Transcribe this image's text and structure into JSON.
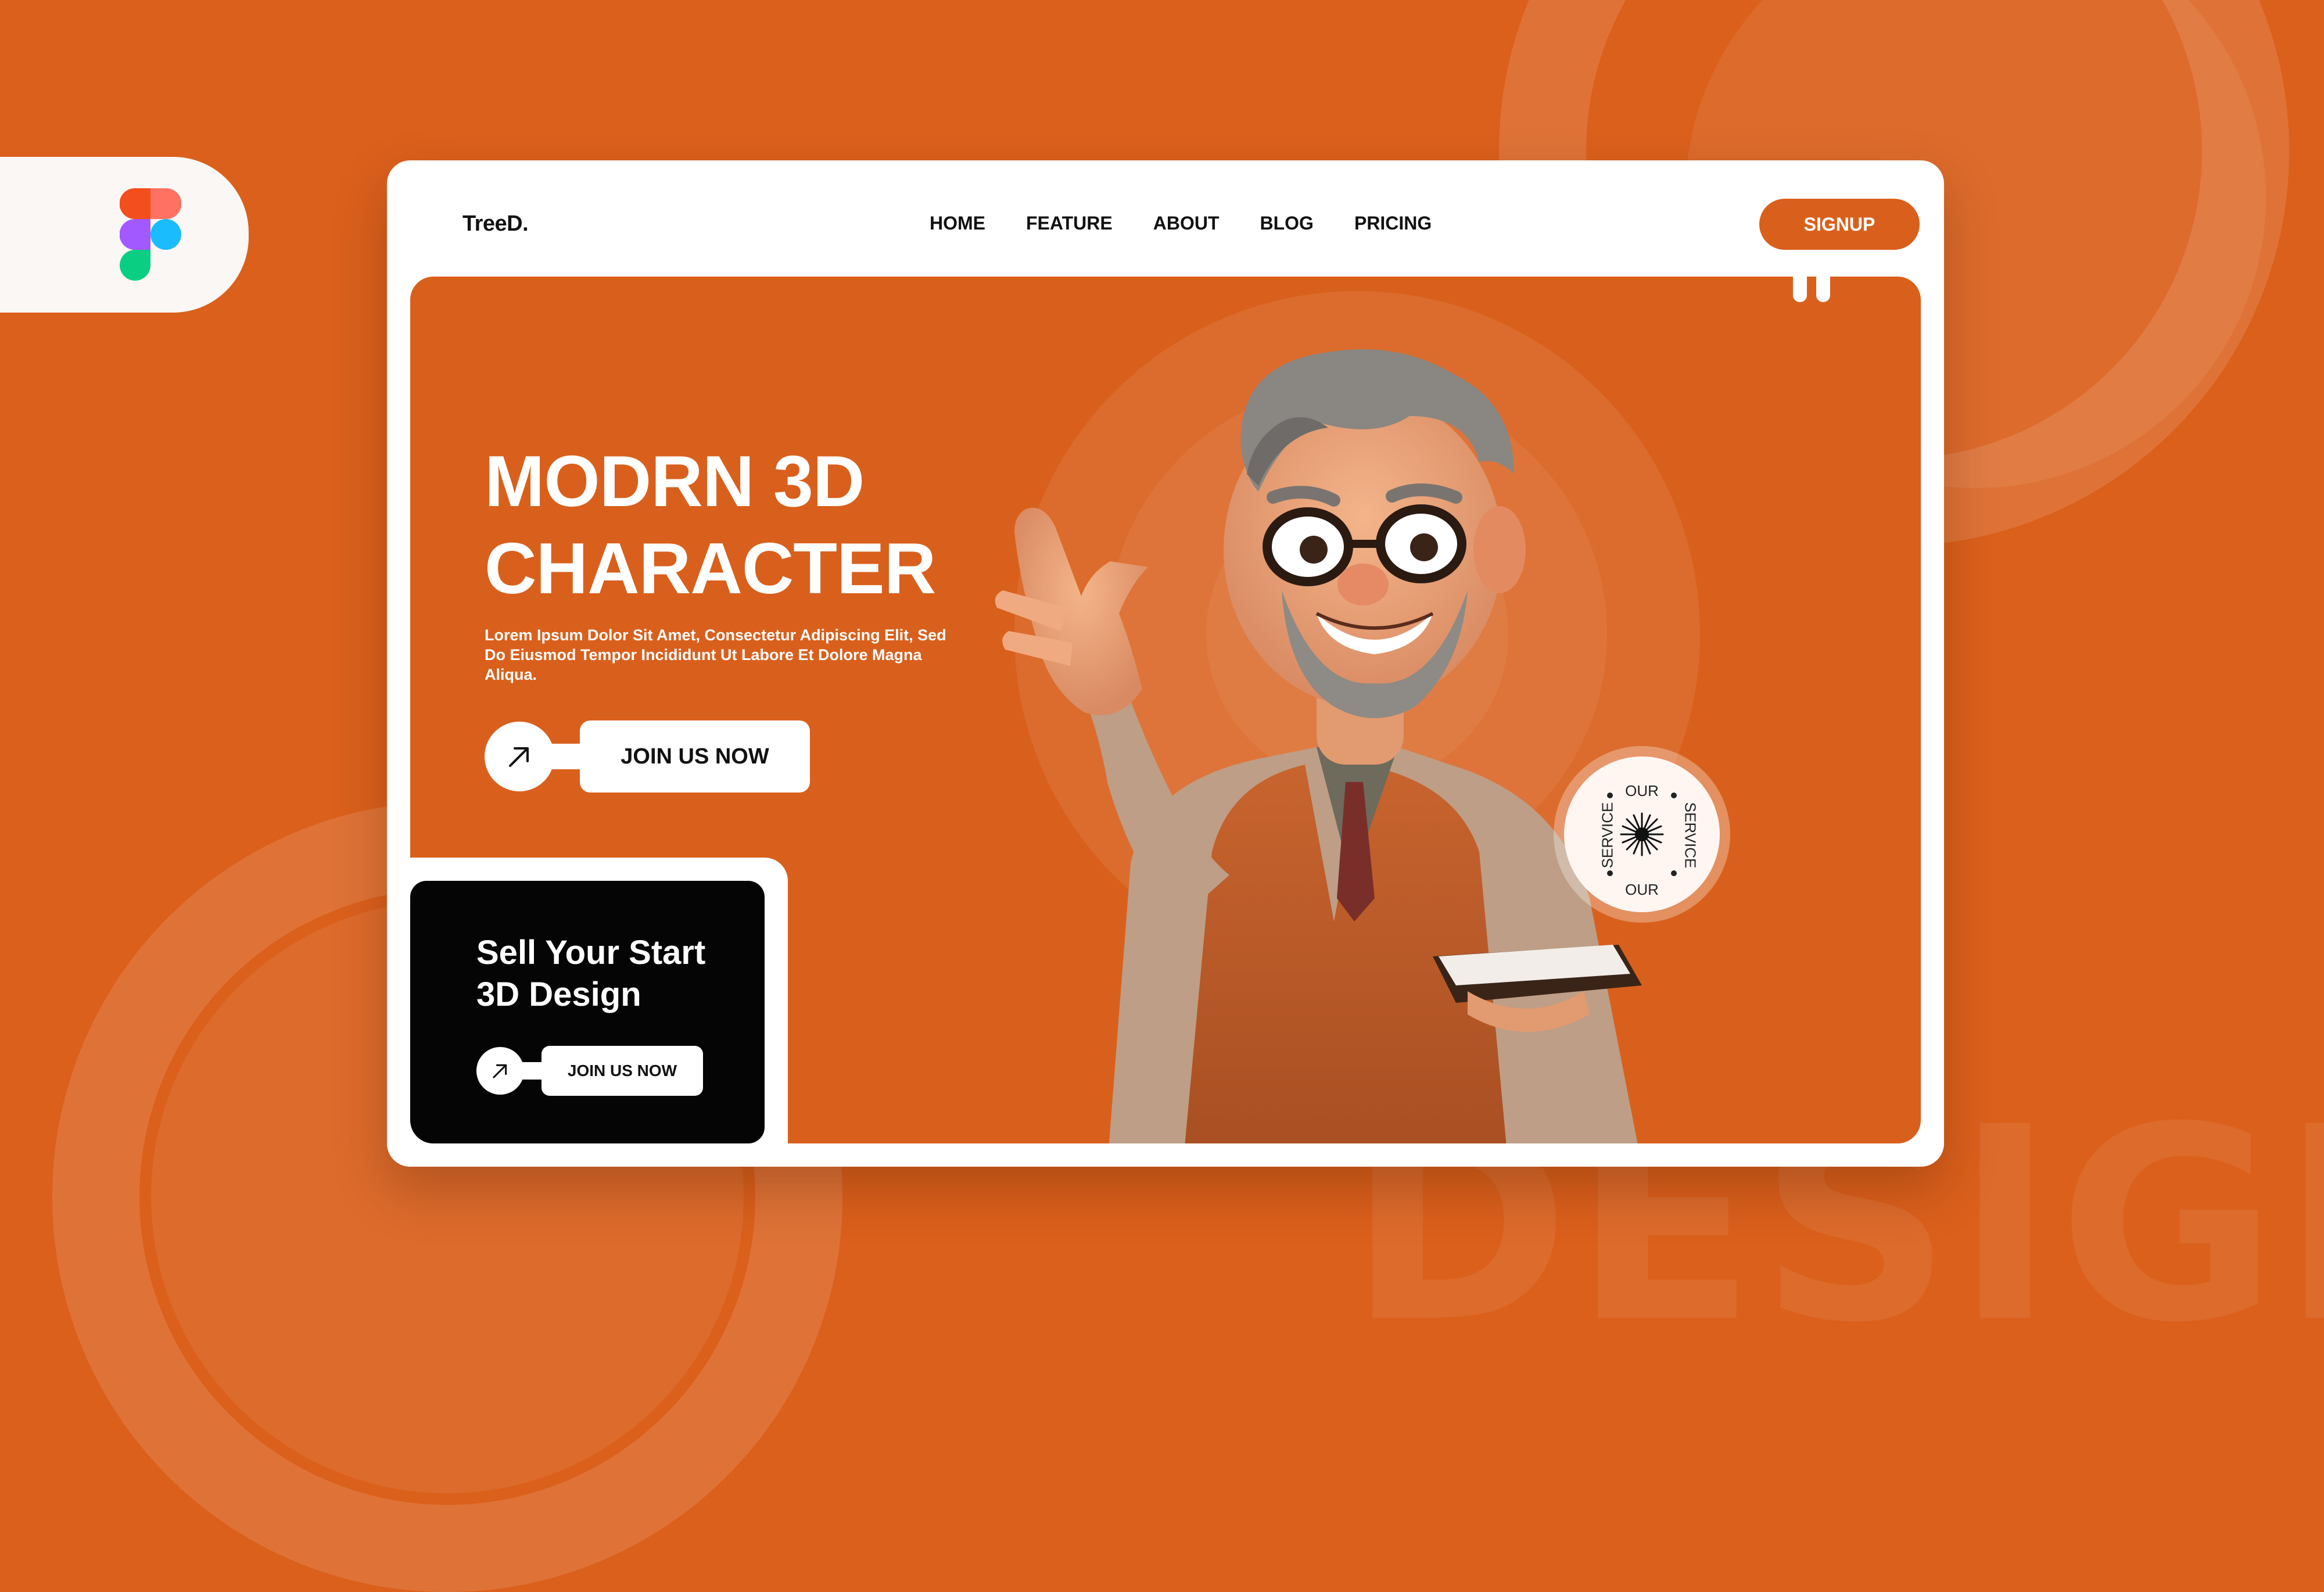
{
  "colors": {
    "brand_orange": "#D9601C",
    "background_orange": "#DB601C",
    "white": "#FFFFFF",
    "black_card": "#050505",
    "badge_disc": "#FFF6F2"
  },
  "background": {
    "watermark_text": "DESIGN"
  },
  "figma_tab": {
    "icon": "figma-logo-icon"
  },
  "nav": {
    "logo": "TreeD.",
    "links": [
      "HOME",
      "FEATURE",
      "ABOUT",
      "BLOG",
      "PRICING"
    ],
    "signup_label": "SIGNUP"
  },
  "hero": {
    "title_lines": [
      "MODRN 3D",
      "CHARACTER"
    ],
    "description": "Lorem Ipsum Dolor Sit Amet, Consectetur Adipiscing Elit, Sed Do Eiusmod Tempor Incididunt Ut Labore Et Dolore Magna Aliqua.",
    "cta_label": "JOIN US NOW",
    "cta_icon": "arrow-up-right-icon",
    "character_image": "3d-character-illustration"
  },
  "promo_card": {
    "title_lines": [
      "Sell Your Start",
      "3D Design"
    ],
    "cta_label": "JOIN US NOW",
    "cta_icon": "arrow-up-right-icon"
  },
  "badge": {
    "top": "OUR",
    "bottom": "OUR",
    "left": "SERVICE",
    "right": "SERVICE",
    "icon": "starburst-icon"
  }
}
